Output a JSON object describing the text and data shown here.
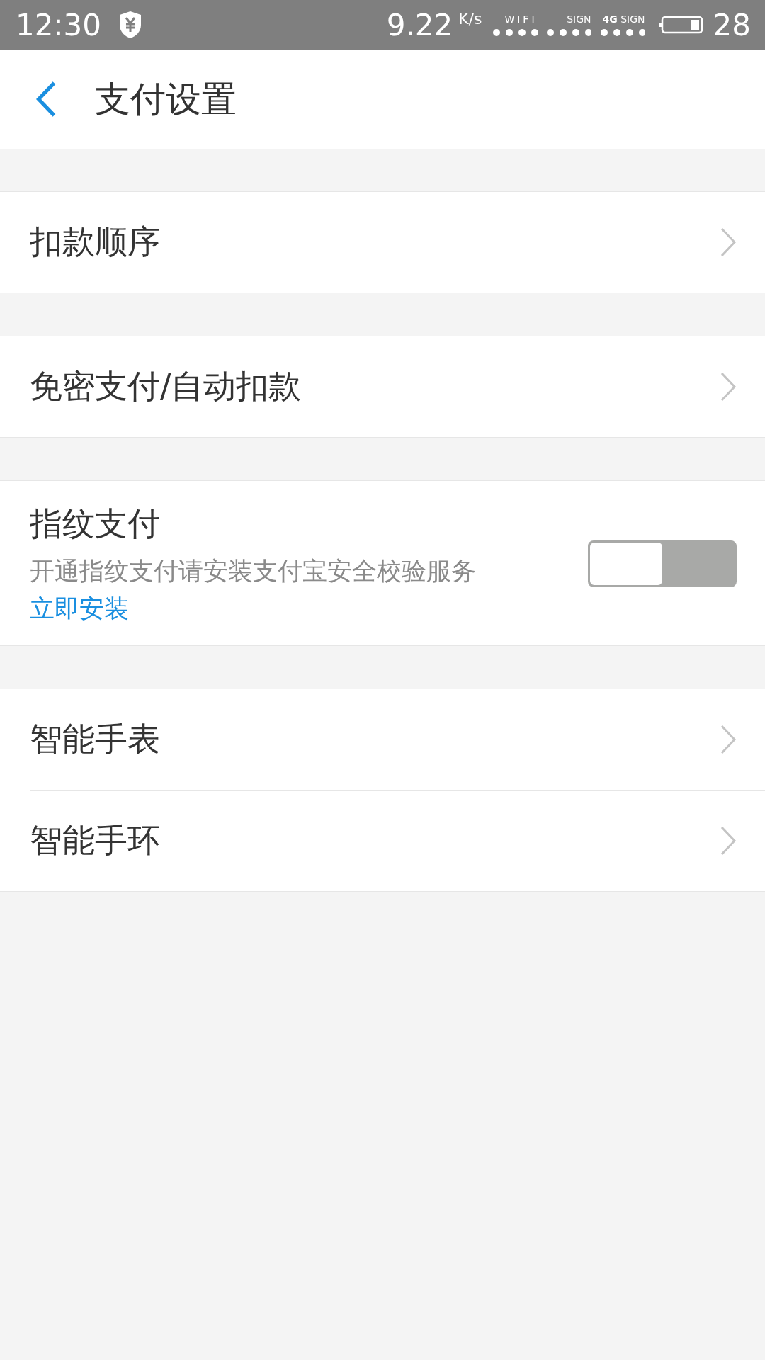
{
  "status_bar": {
    "time": "12:30",
    "speed": "9.22",
    "speed_unit": "K/s",
    "wifi_label": "WIFI",
    "sim1_label": "SIGN",
    "sim2_network": "4G",
    "sim2_label": "SIGN",
    "battery": "28"
  },
  "header": {
    "title": "支付设置"
  },
  "sections": [
    {
      "items": [
        {
          "kind": "link",
          "label": "扣款顺序"
        }
      ]
    },
    {
      "items": [
        {
          "kind": "link",
          "label": "免密支付/自动扣款"
        }
      ]
    },
    {
      "items": [
        {
          "kind": "toggle",
          "label": "指纹支付",
          "description": "开通指纹支付请安装支付宝安全校验服务",
          "action": "立即安装",
          "on": false
        }
      ]
    },
    {
      "items": [
        {
          "kind": "link",
          "label": "智能手表"
        },
        {
          "kind": "link",
          "label": "智能手环"
        }
      ]
    }
  ]
}
